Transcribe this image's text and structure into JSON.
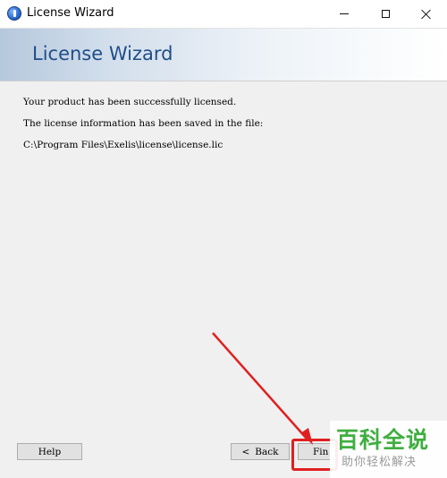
{
  "window": {
    "title": "License Wizard"
  },
  "banner": {
    "title": "License Wizard"
  },
  "content": {
    "line1": "Your product has been successfully licensed.",
    "line2": "The license information has been saved in the file:",
    "line3": "C:\\Program Files\\Exelis\\license\\license.lic"
  },
  "buttons": {
    "help": "Help",
    "back_arrow": "<",
    "back": "Back",
    "finish": "Fin"
  },
  "watermark": {
    "main": "百科全说",
    "sub": "助你轻松解决"
  },
  "colors": {
    "banner_title": "#1f4e89",
    "annotation": "#e02020",
    "watermark_main": "#3fae3f"
  },
  "icons": {
    "app": "info-globe-icon",
    "minimize": "minimize-icon",
    "maximize": "maximize-icon",
    "close": "close-icon"
  }
}
